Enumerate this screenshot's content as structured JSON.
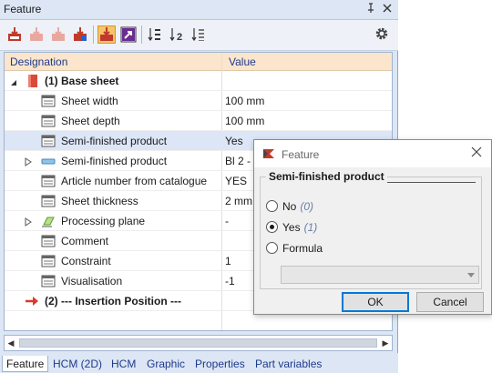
{
  "panel": {
    "title": "Feature",
    "pin_glyph": "⊥",
    "close_glyph": "✕"
  },
  "toolbar": {
    "icons": [
      "apply-icon",
      "apply-disabled-icon",
      "apply-disabled-2-icon",
      "apply-all-icon",
      "autocalc-icon",
      "jump-icon",
      "sort-icon",
      "sort-2-icon",
      "sort-list-icon",
      "settings-icon"
    ]
  },
  "grid": {
    "header_designation": "Designation",
    "header_value": "Value",
    "rows": [
      {
        "name": "(1) Base sheet",
        "value": ""
      },
      {
        "name": "Sheet width",
        "value": "100 mm"
      },
      {
        "name": "Sheet depth",
        "value": "100 mm"
      },
      {
        "name": "Semi-finished product",
        "value": "Yes"
      },
      {
        "name": "Semi-finished product",
        "value": "Bl 2 -"
      },
      {
        "name": "Article number from catalogue",
        "value": "YES"
      },
      {
        "name": "Sheet thickness",
        "value": "2 mm"
      },
      {
        "name": "Processing plane",
        "value": "-"
      },
      {
        "name": "Comment",
        "value": ""
      },
      {
        "name": "Constraint",
        "value": "1"
      },
      {
        "name": "Visualisation",
        "value": "-1"
      },
      {
        "name": "(2) --- Insertion Position ---",
        "value": ""
      }
    ]
  },
  "tabs": [
    {
      "label": "Feature"
    },
    {
      "label": "HCM (2D)"
    },
    {
      "label": "HCM"
    },
    {
      "label": "Graphic"
    },
    {
      "label": "Properties"
    },
    {
      "label": "Part variables"
    }
  ],
  "dialog": {
    "title": "Feature",
    "group_label": "Semi-finished product",
    "options": [
      {
        "label": "No",
        "hint": "(0)",
        "selected": false
      },
      {
        "label": "Yes",
        "hint": "(1)",
        "selected": true
      },
      {
        "label": "Formula",
        "hint": "",
        "selected": false
      }
    ],
    "formula_value": "",
    "ok_label": "OK",
    "cancel_label": "Cancel"
  },
  "colors": {
    "panel_bg": "#dce6f4",
    "header_bg": "#fbe5cc",
    "accent": "#0078d7",
    "selected_row": "#dce6f6"
  }
}
